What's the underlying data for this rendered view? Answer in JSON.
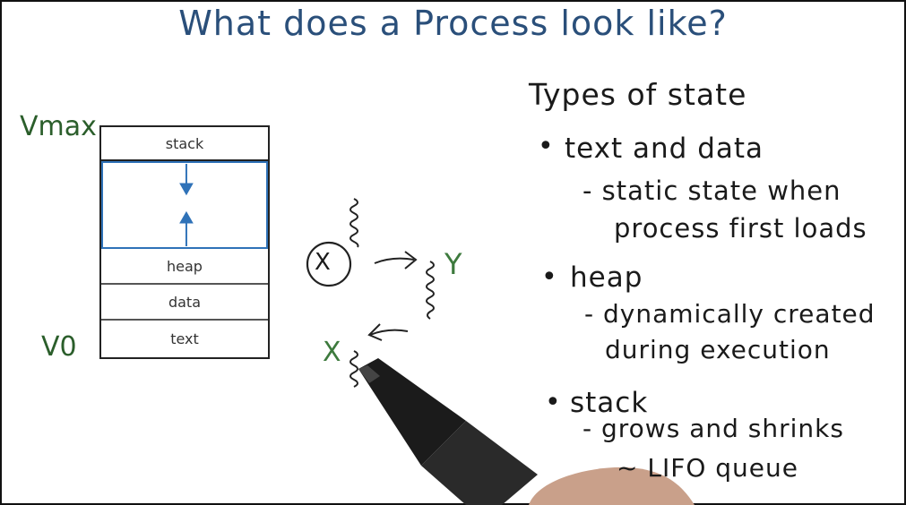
{
  "title": "What does a Process look like?",
  "axis": {
    "vmax": "Vmax",
    "v0": "V0"
  },
  "segments": {
    "stack": "stack",
    "heap": "heap",
    "data": "data",
    "text": "text"
  },
  "threads": {
    "x_circled": "X",
    "y": "Y",
    "x": "X"
  },
  "notes": {
    "heading": "Types of state",
    "b1": "text and data",
    "b1_sub1": "- static state when",
    "b1_sub2": "process first loads",
    "b2": "heap",
    "b2_sub1": "- dynamically created",
    "b2_sub2": "during execution",
    "b3": "stack",
    "b3_sub1": "- grows and shrinks",
    "b3_sub2": "~ LIFO queue"
  }
}
